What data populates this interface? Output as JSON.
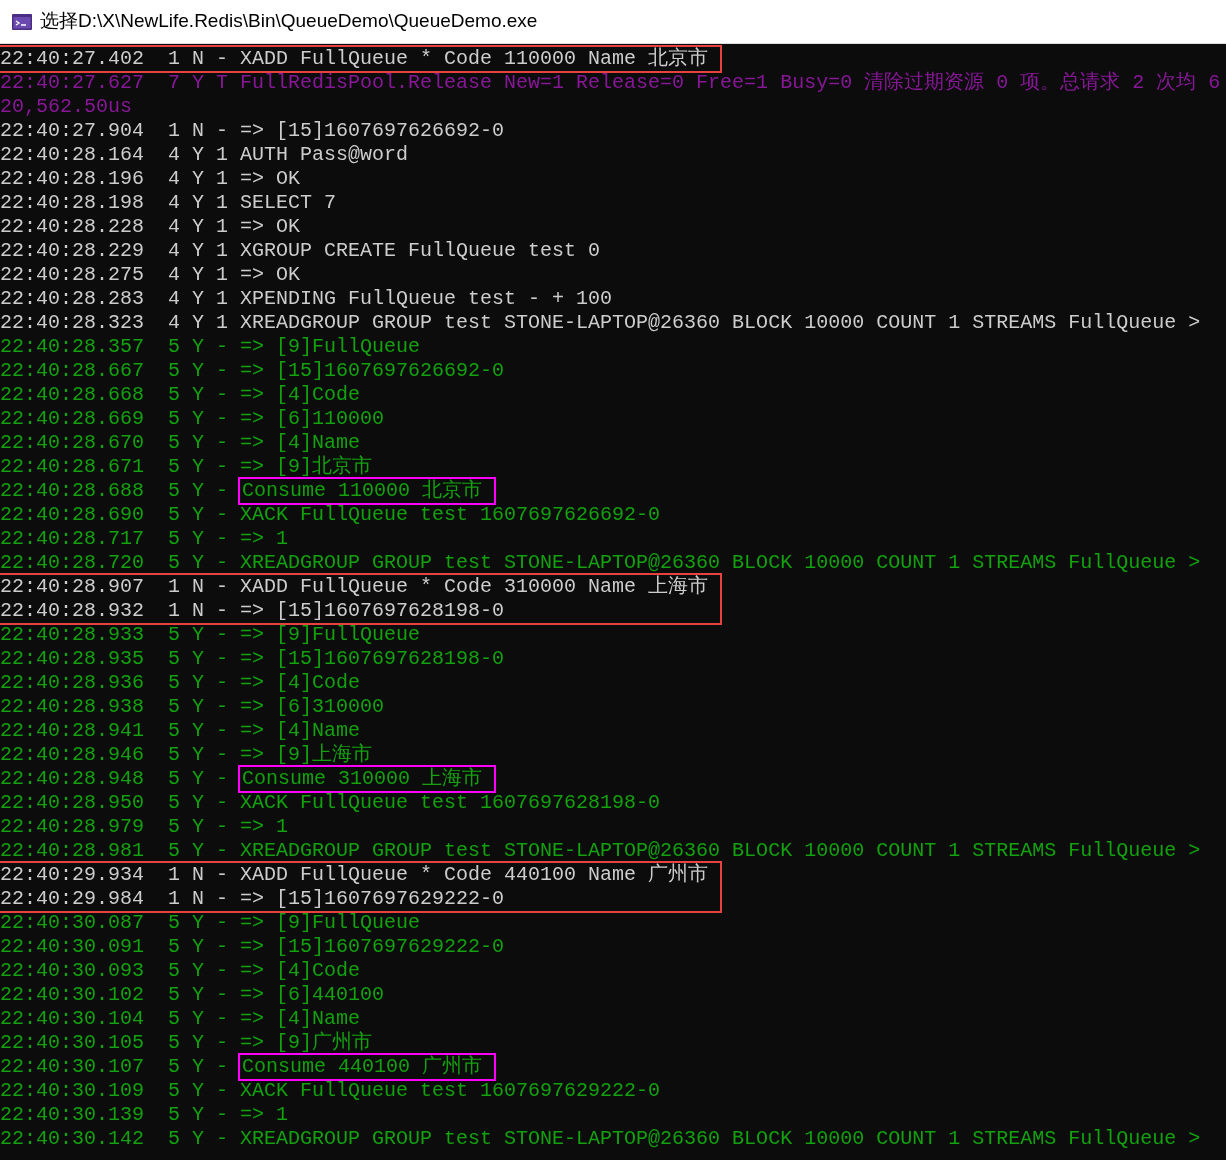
{
  "window": {
    "title": "选择D:\\X\\NewLife.Redis\\Bin\\QueueDemo\\QueueDemo.exe"
  },
  "console": {
    "blocks": [
      {
        "boxed": true,
        "lines": [
          {
            "kind": "command",
            "text": "22:40:27.402  1 N - XADD FullQueue * Code 110000 Name 北京市"
          }
        ]
      },
      {
        "boxed": false,
        "lines": [
          {
            "kind": "pool",
            "text": "22:40:27.627  7 Y T FullRedisPool.Release New=1 Release=0 Free=1 Busy=0 清除过期资源 0 项。总请求 2 次均 620,562.50us"
          },
          {
            "kind": "command",
            "text": "22:40:27.904  1 N - => [15]1607697626692-0"
          },
          {
            "kind": "command",
            "text": "22:40:28.164  4 Y 1 AUTH Pass@word"
          },
          {
            "kind": "command",
            "text": "22:40:28.196  4 Y 1 => OK"
          },
          {
            "kind": "command",
            "text": "22:40:28.198  4 Y 1 SELECT 7"
          },
          {
            "kind": "command",
            "text": "22:40:28.228  4 Y 1 => OK"
          },
          {
            "kind": "command",
            "text": "22:40:28.229  4 Y 1 XGROUP CREATE FullQueue test 0"
          },
          {
            "kind": "command",
            "text": "22:40:28.275  4 Y 1 => OK"
          },
          {
            "kind": "command",
            "text": "22:40:28.283  4 Y 1 XPENDING FullQueue test - + 100"
          },
          {
            "kind": "command",
            "text": "22:40:28.323  4 Y 1 XREADGROUP GROUP test STONE-LAPTOP@26360 BLOCK 10000 COUNT 1 STREAMS FullQueue >"
          },
          {
            "kind": "consumer",
            "text": "22:40:28.357  5 Y - => [9]FullQueue"
          },
          {
            "kind": "consumer",
            "text": "22:40:28.667  5 Y - => [15]1607697626692-0"
          },
          {
            "kind": "consumer",
            "text": "22:40:28.668  5 Y - => [4]Code"
          },
          {
            "kind": "consumer",
            "text": "22:40:28.669  5 Y - => [6]110000"
          },
          {
            "kind": "consumer",
            "text": "22:40:28.670  5 Y - => [4]Name"
          },
          {
            "kind": "consumer",
            "text": "22:40:28.671  5 Y - => [9]北京市"
          },
          {
            "kind": "consumer",
            "text": "22:40:28.688  5 Y -",
            "highlight": "Consume 110000 北京市"
          },
          {
            "kind": "consumer",
            "text": "22:40:28.690  5 Y - XACK FullQueue test 1607697626692-0"
          },
          {
            "kind": "consumer",
            "text": "22:40:28.717  5 Y - => 1"
          },
          {
            "kind": "consumer",
            "text": "22:40:28.720  5 Y - XREADGROUP GROUP test STONE-LAPTOP@26360 BLOCK 10000 COUNT 1 STREAMS FullQueue >"
          }
        ]
      },
      {
        "boxed": true,
        "lines": [
          {
            "kind": "command",
            "text": "22:40:28.907  1 N - XADD FullQueue * Code 310000 Name 上海市"
          },
          {
            "kind": "command",
            "text": "22:40:28.932  1 N - => [15]1607697628198-0"
          }
        ]
      },
      {
        "boxed": false,
        "lines": [
          {
            "kind": "consumer",
            "text": "22:40:28.933  5 Y - => [9]FullQueue"
          },
          {
            "kind": "consumer",
            "text": "22:40:28.935  5 Y - => [15]1607697628198-0"
          },
          {
            "kind": "consumer",
            "text": "22:40:28.936  5 Y - => [4]Code"
          },
          {
            "kind": "consumer",
            "text": "22:40:28.938  5 Y - => [6]310000"
          },
          {
            "kind": "consumer",
            "text": "22:40:28.941  5 Y - => [4]Name"
          },
          {
            "kind": "consumer",
            "text": "22:40:28.946  5 Y - => [9]上海市"
          },
          {
            "kind": "consumer",
            "text": "22:40:28.948  5 Y -",
            "highlight": "Consume 310000 上海市"
          },
          {
            "kind": "consumer",
            "text": "22:40:28.950  5 Y - XACK FullQueue test 1607697628198-0"
          },
          {
            "kind": "consumer",
            "text": "22:40:28.979  5 Y - => 1"
          },
          {
            "kind": "consumer",
            "text": "22:40:28.981  5 Y - XREADGROUP GROUP test STONE-LAPTOP@26360 BLOCK 10000 COUNT 1 STREAMS FullQueue >"
          }
        ]
      },
      {
        "boxed": true,
        "lines": [
          {
            "kind": "command",
            "text": "22:40:29.934  1 N - XADD FullQueue * Code 440100 Name 广州市"
          },
          {
            "kind": "command",
            "text": "22:40:29.984  1 N - => [15]1607697629222-0"
          }
        ]
      },
      {
        "boxed": false,
        "lines": [
          {
            "kind": "consumer",
            "text": "22:40:30.087  5 Y - => [9]FullQueue"
          },
          {
            "kind": "consumer",
            "text": "22:40:30.091  5 Y - => [15]1607697629222-0"
          },
          {
            "kind": "consumer",
            "text": "22:40:30.093  5 Y - => [4]Code"
          },
          {
            "kind": "consumer",
            "text": "22:40:30.102  5 Y - => [6]440100"
          },
          {
            "kind": "consumer",
            "text": "22:40:30.104  5 Y - => [4]Name"
          },
          {
            "kind": "consumer",
            "text": "22:40:30.105  5 Y - => [9]广州市"
          },
          {
            "kind": "consumer",
            "text": "22:40:30.107  5 Y -",
            "highlight": "Consume 440100 广州市"
          },
          {
            "kind": "consumer",
            "text": "22:40:30.109  5 Y - XACK FullQueue test 1607697629222-0"
          },
          {
            "kind": "consumer",
            "text": "22:40:30.139  5 Y - => 1"
          },
          {
            "kind": "consumer",
            "text": "22:40:30.142  5 Y - XREADGROUP GROUP test STONE-LAPTOP@26360 BLOCK 10000 COUNT 1 STREAMS FullQueue >"
          }
        ]
      }
    ]
  }
}
